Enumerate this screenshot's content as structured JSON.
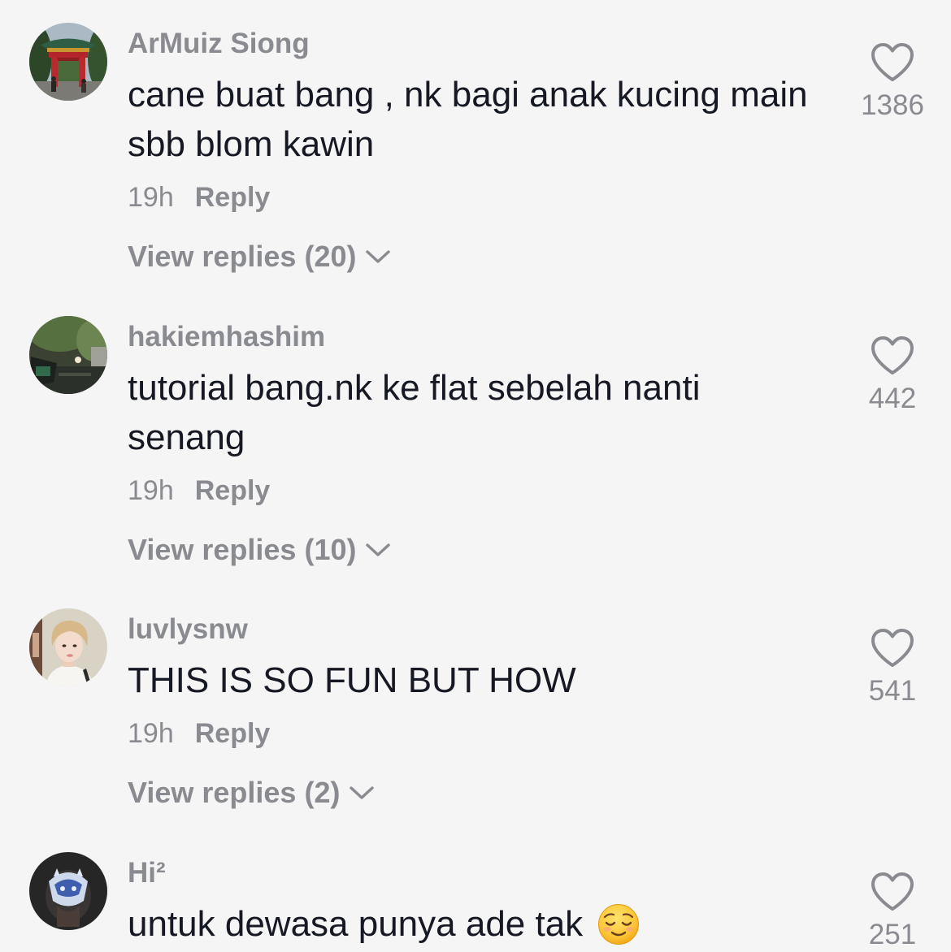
{
  "theme": {
    "background": "#f5f5f5",
    "primary_text": "#161823",
    "secondary_text": "#8a8b91"
  },
  "icons": {
    "like": "heart-outline-icon",
    "expand": "chevron-down-icon"
  },
  "comments": [
    {
      "username": "ArMuiz Siong",
      "text": [
        "cane buat bang , nk bagi anak kucing main",
        "sbb blom kawin"
      ],
      "time": "19h",
      "reply_label": "Reply",
      "view_replies_label": "View replies (20)",
      "likes": "1386"
    },
    {
      "username": "hakiemhashim",
      "text": [
        "tutorial bang.nk ke flat sebelah nanti",
        "senang"
      ],
      "time": "19h",
      "reply_label": "Reply",
      "view_replies_label": "View replies (10)",
      "likes": "442"
    },
    {
      "username": "luvlysnw",
      "text": [
        "THIS IS SO FUN BUT HOW"
      ],
      "time": "19h",
      "reply_label": "Reply",
      "view_replies_label": "View replies (2)",
      "likes": "541"
    },
    {
      "username": "Hi²",
      "text": [
        "untuk dewasa punya ade tak"
      ],
      "emoji": "relieved-face-emoji",
      "likes": "251"
    }
  ]
}
